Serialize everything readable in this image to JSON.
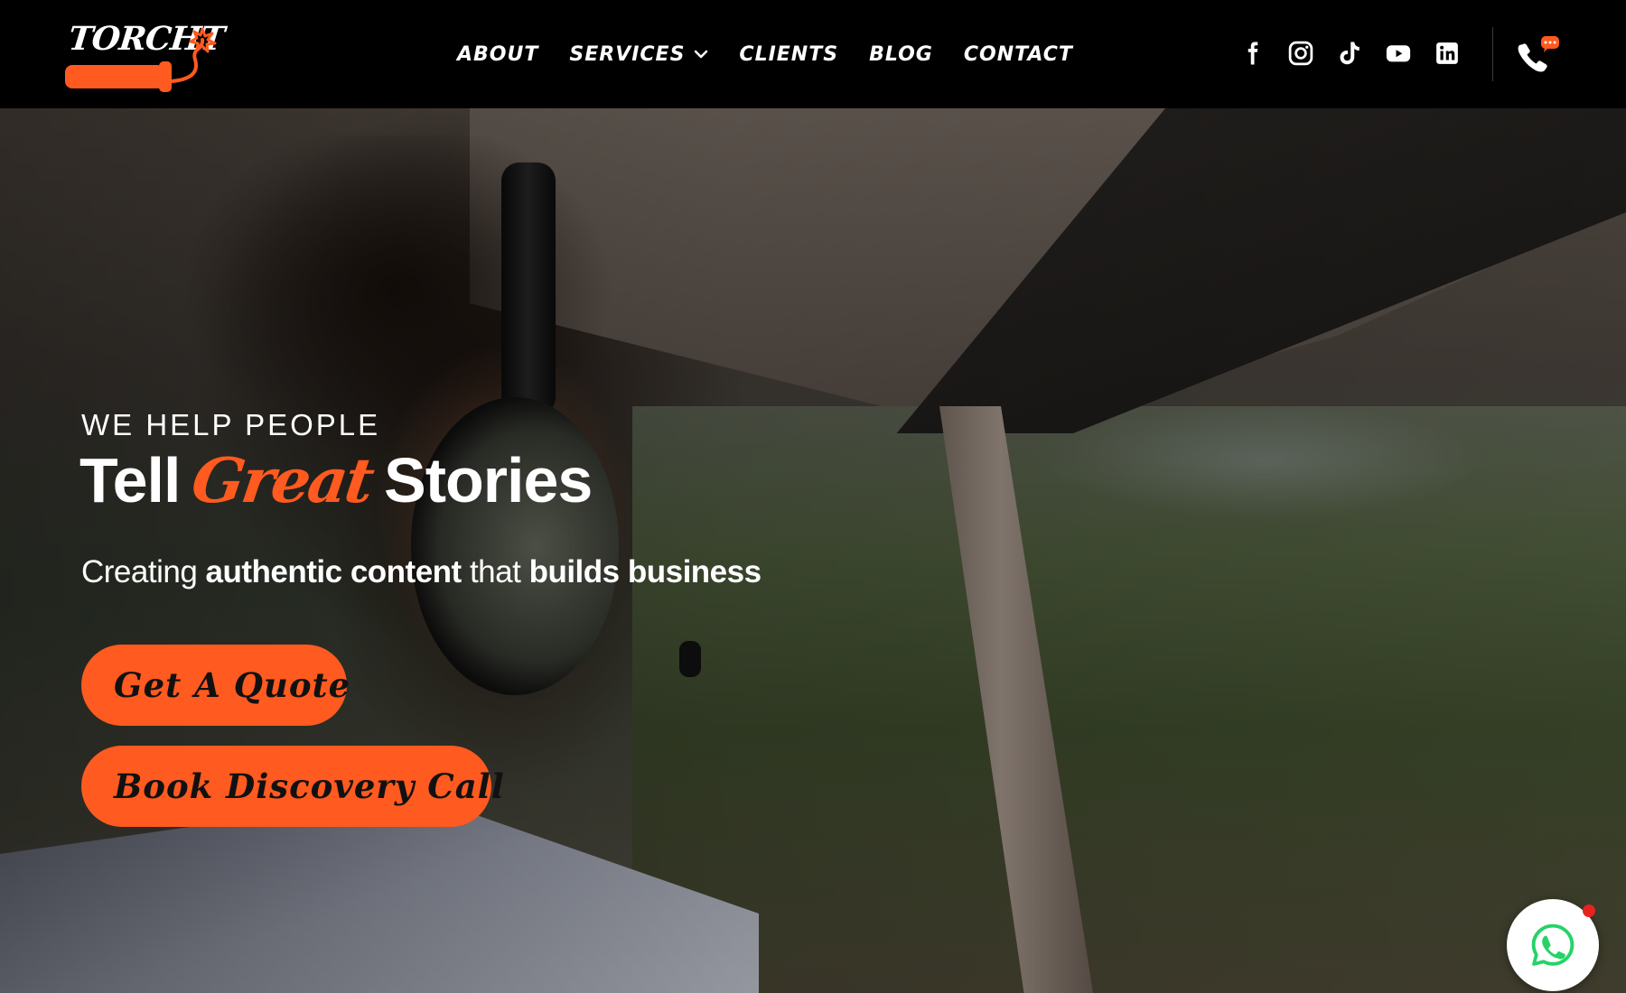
{
  "brand": {
    "logo_text": "TORCHT",
    "accent_color": "#ff5a1f"
  },
  "nav": {
    "items": [
      {
        "label": "ABOUT"
      },
      {
        "label": "SERVICES",
        "has_dropdown": true
      },
      {
        "label": "CLIENTS"
      },
      {
        "label": "BLOG"
      },
      {
        "label": "CONTACT"
      }
    ]
  },
  "socials": [
    "facebook-icon",
    "instagram-icon",
    "tiktok-icon",
    "youtube-icon",
    "linkedin-icon"
  ],
  "hero": {
    "eyebrow": "WE HELP PEOPLE",
    "headline_part1": "Tell",
    "headline_accent": "Great",
    "headline_part2": "Stories",
    "sub_part1": "Creating",
    "sub_bold1": "authentic content",
    "sub_part2": "that",
    "sub_bold2": "builds business"
  },
  "cta": {
    "quote_label": "Get A Quote",
    "call_label": "Book Discovery Call"
  },
  "widgets": {
    "whatsapp": "whatsapp-icon",
    "notification_color": "#e8231f"
  }
}
